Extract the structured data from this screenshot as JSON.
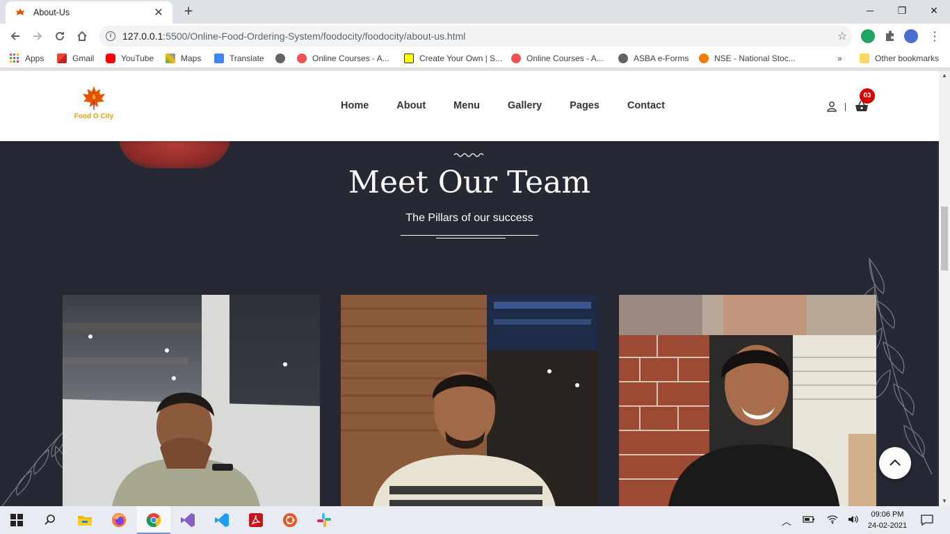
{
  "browser": {
    "tab_title": "About-Us",
    "tab_close": "✕",
    "new_tab": "+",
    "url_host": "127.0.0.1",
    "url_rest": ":5500/Online-Food-Ordering-System/foodocity/foodocity/about-us.html"
  },
  "bookmarks": {
    "items": [
      "Apps",
      "Gmail",
      "YouTube",
      "Maps",
      "Translate",
      "Online Courses - A...",
      "Create Your Own | S...",
      "Online Courses - A...",
      "ASBA e-Forms",
      "NSE - National Stoc..."
    ],
    "overflow": "»",
    "other": "Other bookmarks"
  },
  "site": {
    "logo_text": "Food O City",
    "nav": [
      "Home",
      "About",
      "Menu",
      "Gallery",
      "Pages",
      "Contact"
    ],
    "cart_count": "03"
  },
  "team": {
    "title": "Meet Our Team",
    "subtitle": "The Pillars of our success"
  },
  "taskbar": {
    "time": "09:06 PM",
    "date": "24-02-2021"
  },
  "colors": {
    "page_bg": "#262833",
    "accent_red": "#d50000",
    "logo_yellow": "#e0a300"
  }
}
